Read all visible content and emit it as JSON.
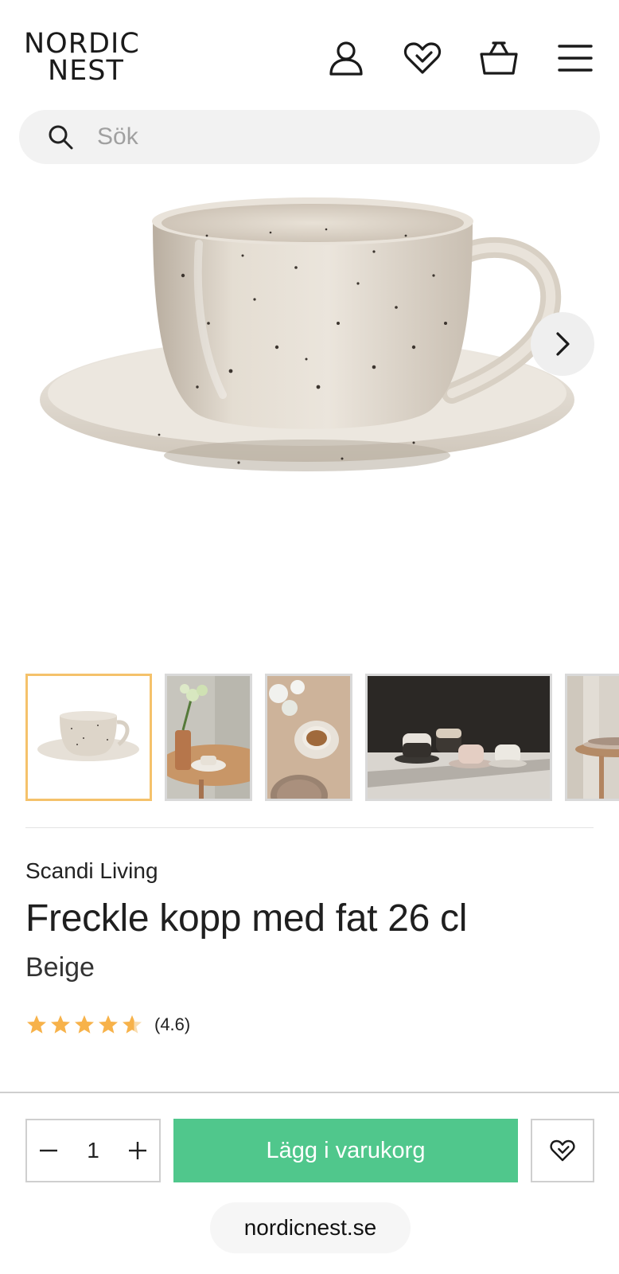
{
  "header": {
    "logo_line1": "NORDIC",
    "logo_line2": "NEST",
    "icons": [
      "account-icon",
      "wishlist-icon",
      "cart-icon",
      "menu-icon"
    ]
  },
  "search": {
    "placeholder": "Sök"
  },
  "gallery": {
    "main_image": "Freckle cup with saucer, beige speckled",
    "thumbnails": [
      "cup-saucer",
      "cup-on-table-with-flowers",
      "cup-top-view",
      "cups-group-dark",
      "plates-on-table"
    ],
    "active_thumbnail": 0
  },
  "product": {
    "brand": "Scandi Living",
    "title": "Freckle kopp med fat 26 cl",
    "color": "Beige",
    "rating_value": 4.6,
    "rating_text": "(4.6)",
    "stars_max": 5
  },
  "purchase": {
    "quantity": "1",
    "add_to_cart_label": "Lägg i varukorg"
  },
  "footer": {
    "domain": "nordicnest.se"
  },
  "colors": {
    "accent_green": "#50c78c",
    "star": "#f7b24a",
    "active_thumb_border": "#f5c26b"
  }
}
